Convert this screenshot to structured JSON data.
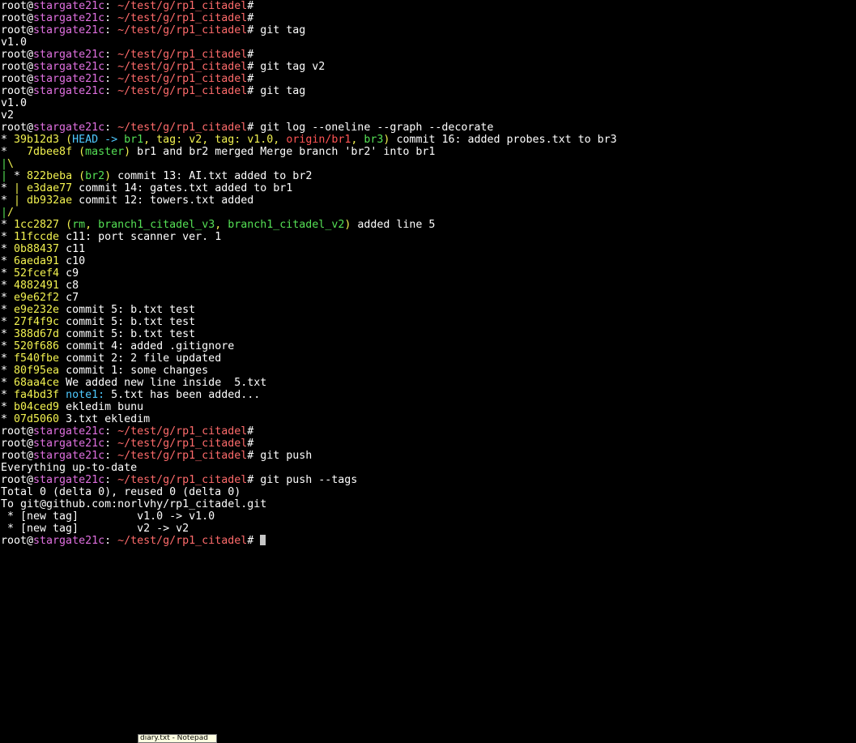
{
  "colors": {
    "default": "#ffffff",
    "user": "#ffffff",
    "host": "#e070e0",
    "path": "#ff6b6b",
    "hash": "#f2f250",
    "head": "#4ec9ff",
    "branch_local": "#55e055",
    "branch_remote": "#ff5555",
    "tag": "#f2f250",
    "graph_green": "#55e055",
    "graph_yellow": "#f2f250",
    "graph_purple": "#e070e0"
  },
  "terminal": {
    "lines": [
      [
        {
          "t": "root@",
          "c": "user"
        },
        {
          "t": "stargate21c",
          "c": "host"
        },
        {
          "t": ": ",
          "c": "default"
        },
        {
          "t": "~/test/g/rp1_citadel",
          "c": "path"
        },
        {
          "t": "#",
          "c": "default"
        }
      ],
      [
        {
          "t": "root@",
          "c": "user"
        },
        {
          "t": "stargate21c",
          "c": "host"
        },
        {
          "t": ": ",
          "c": "default"
        },
        {
          "t": "~/test/g/rp1_citadel",
          "c": "path"
        },
        {
          "t": "#",
          "c": "default"
        }
      ],
      [
        {
          "t": "root@",
          "c": "user"
        },
        {
          "t": "stargate21c",
          "c": "host"
        },
        {
          "t": ": ",
          "c": "default"
        },
        {
          "t": "~/test/g/rp1_citadel",
          "c": "path"
        },
        {
          "t": "# git tag",
          "c": "default"
        }
      ],
      [
        {
          "t": "v1.0",
          "c": "default"
        }
      ],
      [
        {
          "t": "root@",
          "c": "user"
        },
        {
          "t": "stargate21c",
          "c": "host"
        },
        {
          "t": ": ",
          "c": "default"
        },
        {
          "t": "~/test/g/rp1_citadel",
          "c": "path"
        },
        {
          "t": "#",
          "c": "default"
        }
      ],
      [
        {
          "t": "root@",
          "c": "user"
        },
        {
          "t": "stargate21c",
          "c": "host"
        },
        {
          "t": ": ",
          "c": "default"
        },
        {
          "t": "~/test/g/rp1_citadel",
          "c": "path"
        },
        {
          "t": "# git tag v2",
          "c": "default"
        }
      ],
      [
        {
          "t": "root@",
          "c": "user"
        },
        {
          "t": "stargate21c",
          "c": "host"
        },
        {
          "t": ": ",
          "c": "default"
        },
        {
          "t": "~/test/g/rp1_citadel",
          "c": "path"
        },
        {
          "t": "#",
          "c": "default"
        }
      ],
      [
        {
          "t": "root@",
          "c": "user"
        },
        {
          "t": "stargate21c",
          "c": "host"
        },
        {
          "t": ": ",
          "c": "default"
        },
        {
          "t": "~/test/g/rp1_citadel",
          "c": "path"
        },
        {
          "t": "# git tag",
          "c": "default"
        }
      ],
      [
        {
          "t": "v1.0",
          "c": "default"
        }
      ],
      [
        {
          "t": "v2",
          "c": "default"
        }
      ],
      [
        {
          "t": "root@",
          "c": "user"
        },
        {
          "t": "stargate21c",
          "c": "host"
        },
        {
          "t": ": ",
          "c": "default"
        },
        {
          "t": "~/test/g/rp1_citadel",
          "c": "path"
        },
        {
          "t": "# git log --oneline --graph --decorate",
          "c": "default"
        }
      ],
      [
        {
          "t": "* ",
          "c": "default"
        },
        {
          "t": "39b12d3",
          "c": "hash"
        },
        {
          "t": " (",
          "c": "hash"
        },
        {
          "t": "HEAD -> ",
          "c": "head"
        },
        {
          "t": "br1",
          "c": "branch_local"
        },
        {
          "t": ", ",
          "c": "hash"
        },
        {
          "t": "tag: v2",
          "c": "tag"
        },
        {
          "t": ", ",
          "c": "hash"
        },
        {
          "t": "tag: v1.0",
          "c": "tag"
        },
        {
          "t": ", ",
          "c": "hash"
        },
        {
          "t": "origin/br1",
          "c": "branch_remote"
        },
        {
          "t": ", ",
          "c": "hash"
        },
        {
          "t": "br3",
          "c": "branch_local"
        },
        {
          "t": ")",
          "c": "hash"
        },
        {
          "t": " commit 16: added probes.txt to br3",
          "c": "default"
        }
      ],
      [
        {
          "t": "*   ",
          "c": "default"
        },
        {
          "t": "7dbee8f",
          "c": "hash"
        },
        {
          "t": " (",
          "c": "hash"
        },
        {
          "t": "master",
          "c": "branch_local"
        },
        {
          "t": ")",
          "c": "hash"
        },
        {
          "t": " br1 and br2 merged Merge branch 'br2' into br1",
          "c": "default"
        }
      ],
      [
        {
          "t": "|",
          "c": "graph_green"
        },
        {
          "t": "\\",
          "c": "graph_yellow"
        }
      ],
      [
        {
          "t": "|",
          "c": "graph_green"
        },
        {
          "t": " * ",
          "c": "default"
        },
        {
          "t": "822beba",
          "c": "hash"
        },
        {
          "t": " (",
          "c": "hash"
        },
        {
          "t": "br2",
          "c": "branch_local"
        },
        {
          "t": ")",
          "c": "hash"
        },
        {
          "t": " commit 13: AI.txt added to br2",
          "c": "default"
        }
      ],
      [
        {
          "t": "* ",
          "c": "default"
        },
        {
          "t": "|",
          "c": "graph_yellow"
        },
        {
          "t": " ",
          "c": "default"
        },
        {
          "t": "e3dae77",
          "c": "hash"
        },
        {
          "t": " commit 14: gates.txt added to br1",
          "c": "default"
        }
      ],
      [
        {
          "t": "* ",
          "c": "default"
        },
        {
          "t": "|",
          "c": "graph_yellow"
        },
        {
          "t": " ",
          "c": "default"
        },
        {
          "t": "db932ae",
          "c": "hash"
        },
        {
          "t": " commit 12: towers.txt added",
          "c": "default"
        }
      ],
      [
        {
          "t": "|",
          "c": "graph_green"
        },
        {
          "t": "/",
          "c": "graph_yellow"
        }
      ],
      [
        {
          "t": "* ",
          "c": "default"
        },
        {
          "t": "1cc2827",
          "c": "hash"
        },
        {
          "t": " (",
          "c": "hash"
        },
        {
          "t": "rm",
          "c": "branch_local"
        },
        {
          "t": ", ",
          "c": "hash"
        },
        {
          "t": "branch1_citadel_v3",
          "c": "branch_local"
        },
        {
          "t": ", ",
          "c": "hash"
        },
        {
          "t": "branch1_citadel_v2",
          "c": "branch_local"
        },
        {
          "t": ")",
          "c": "hash"
        },
        {
          "t": " added line 5",
          "c": "default"
        }
      ],
      [
        {
          "t": "* ",
          "c": "default"
        },
        {
          "t": "11fccde",
          "c": "hash"
        },
        {
          "t": " c11: port scanner ver. 1",
          "c": "default"
        }
      ],
      [
        {
          "t": "* ",
          "c": "default"
        },
        {
          "t": "0b88437",
          "c": "hash"
        },
        {
          "t": " c11",
          "c": "default"
        }
      ],
      [
        {
          "t": "* ",
          "c": "default"
        },
        {
          "t": "6aeda91",
          "c": "hash"
        },
        {
          "t": " c10",
          "c": "default"
        }
      ],
      [
        {
          "t": "* ",
          "c": "default"
        },
        {
          "t": "52fcef4",
          "c": "hash"
        },
        {
          "t": " c9",
          "c": "default"
        }
      ],
      [
        {
          "t": "* ",
          "c": "default"
        },
        {
          "t": "4882491",
          "c": "hash"
        },
        {
          "t": " c8",
          "c": "default"
        }
      ],
      [
        {
          "t": "* ",
          "c": "default"
        },
        {
          "t": "e9e62f2",
          "c": "hash"
        },
        {
          "t": " c7",
          "c": "default"
        }
      ],
      [
        {
          "t": "* ",
          "c": "default"
        },
        {
          "t": "e9e232e",
          "c": "hash"
        },
        {
          "t": " commit 5: b.txt test",
          "c": "default"
        }
      ],
      [
        {
          "t": "* ",
          "c": "default"
        },
        {
          "t": "27f4f9c",
          "c": "hash"
        },
        {
          "t": " commit 5: b.txt test",
          "c": "default"
        }
      ],
      [
        {
          "t": "* ",
          "c": "default"
        },
        {
          "t": "388d67d",
          "c": "hash"
        },
        {
          "t": " commit 5: b.txt test",
          "c": "default"
        }
      ],
      [
        {
          "t": "* ",
          "c": "default"
        },
        {
          "t": "520f686",
          "c": "hash"
        },
        {
          "t": " commit 4: added .gitignore",
          "c": "default"
        }
      ],
      [
        {
          "t": "* ",
          "c": "default"
        },
        {
          "t": "f540fbe",
          "c": "hash"
        },
        {
          "t": " commit 2: 2 file updated",
          "c": "default"
        }
      ],
      [
        {
          "t": "* ",
          "c": "default"
        },
        {
          "t": "80f95ea",
          "c": "hash"
        },
        {
          "t": " commit 1: some changes",
          "c": "default"
        }
      ],
      [
        {
          "t": "* ",
          "c": "default"
        },
        {
          "t": "68aa4ce",
          "c": "hash"
        },
        {
          "t": " We added new line inside  5.txt",
          "c": "default"
        }
      ],
      [
        {
          "t": "* ",
          "c": "default"
        },
        {
          "t": "fa4bd3f",
          "c": "hash"
        },
        {
          "t": " ",
          "c": "default"
        },
        {
          "t": "note1:",
          "c": "head"
        },
        {
          "t": " 5.txt has been added...",
          "c": "default"
        }
      ],
      [
        {
          "t": "* ",
          "c": "default"
        },
        {
          "t": "b04ced9",
          "c": "hash"
        },
        {
          "t": " ekledim bunu",
          "c": "default"
        }
      ],
      [
        {
          "t": "* ",
          "c": "default"
        },
        {
          "t": "07d5060",
          "c": "hash"
        },
        {
          "t": " 3.txt ekledim",
          "c": "default"
        }
      ],
      [
        {
          "t": "root@",
          "c": "user"
        },
        {
          "t": "stargate21c",
          "c": "host"
        },
        {
          "t": ": ",
          "c": "default"
        },
        {
          "t": "~/test/g/rp1_citadel",
          "c": "path"
        },
        {
          "t": "#",
          "c": "default"
        }
      ],
      [
        {
          "t": "root@",
          "c": "user"
        },
        {
          "t": "stargate21c",
          "c": "host"
        },
        {
          "t": ": ",
          "c": "default"
        },
        {
          "t": "~/test/g/rp1_citadel",
          "c": "path"
        },
        {
          "t": "#",
          "c": "default"
        }
      ],
      [
        {
          "t": "root@",
          "c": "user"
        },
        {
          "t": "stargate21c",
          "c": "host"
        },
        {
          "t": ": ",
          "c": "default"
        },
        {
          "t": "~/test/g/rp1_citadel",
          "c": "path"
        },
        {
          "t": "# git push",
          "c": "default"
        }
      ],
      [
        {
          "t": "Everything up-to-date",
          "c": "default"
        }
      ],
      [
        {
          "t": "root@",
          "c": "user"
        },
        {
          "t": "stargate21c",
          "c": "host"
        },
        {
          "t": ": ",
          "c": "default"
        },
        {
          "t": "~/test/g/rp1_citadel",
          "c": "path"
        },
        {
          "t": "# git push --tags",
          "c": "default"
        }
      ],
      [
        {
          "t": "Total 0 (delta 0), reused 0 (delta 0)",
          "c": "default"
        }
      ],
      [
        {
          "t": "To git@github.com:norlvhy/rp1_citadel.git",
          "c": "default"
        }
      ],
      [
        {
          "t": " * [new tag]         v1.0 -> v1.0",
          "c": "default"
        }
      ],
      [
        {
          "t": " * [new tag]         v2 -> v2",
          "c": "default"
        }
      ],
      [
        {
          "t": "root@",
          "c": "user"
        },
        {
          "t": "stargate21c",
          "c": "host"
        },
        {
          "t": ": ",
          "c": "default"
        },
        {
          "t": "~/test/g/rp1_citadel",
          "c": "path"
        },
        {
          "t": "# ",
          "c": "default"
        }
      ]
    ],
    "cursor_line_index": 44
  },
  "taskbar": {
    "tooltip_text": "diary.txt - Notepad"
  }
}
